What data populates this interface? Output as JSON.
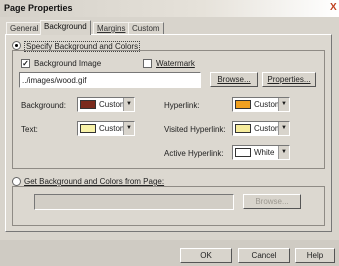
{
  "window": {
    "title": "Page Properties",
    "close_glyph": "X"
  },
  "tabs": [
    {
      "label": "General"
    },
    {
      "label": "Background"
    },
    {
      "label": "Margins"
    },
    {
      "label": "Custom"
    }
  ],
  "specify": {
    "radio_label": "Specify Background and Colors",
    "bg_image_label": "Background Image",
    "bg_image_checked": true,
    "watermark_label": "Watermark",
    "watermark_checked": false,
    "image_path": "../images/wood.gif",
    "browse_label": "Browse...",
    "properties_label": "Properties...",
    "background_label": "Background:",
    "text_label": "Text:",
    "hyperlink_label": "Hyperlink:",
    "visited_label": "Visited Hyperlink:",
    "active_label": "Active Hyperlink:"
  },
  "colors": {
    "background": {
      "text": "Custom",
      "swatch": "#7a2a1c"
    },
    "text": {
      "text": "Custom",
      "swatch": "#f8f2a8"
    },
    "hyperlink": {
      "text": "Custom",
      "swatch": "#f0a020"
    },
    "visited": {
      "text": "Custom",
      "swatch": "#f6ec9c"
    },
    "active": {
      "text": "White",
      "swatch": "#ffffff"
    }
  },
  "get_from_page": {
    "radio_label": "Get Background and Colors from Page:",
    "browse_label": "Browse..."
  },
  "footer": {
    "ok_label": "OK",
    "cancel_label": "Cancel",
    "help_label": "Help"
  }
}
